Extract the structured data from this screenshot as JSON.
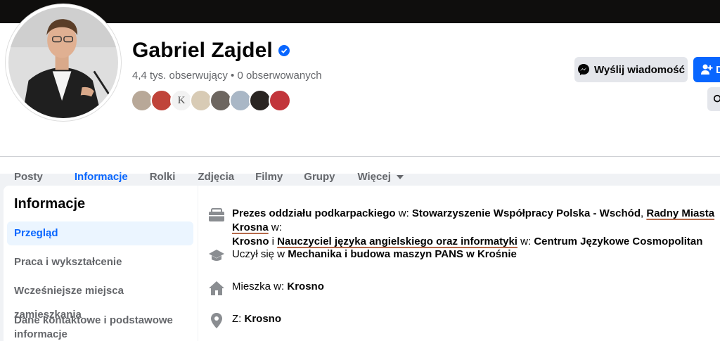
{
  "profile": {
    "name": "Gabriel Zajdel",
    "followers": "4,4 tys. obserwujący • 0 obserwowanych",
    "follower_avatar_letter": "K",
    "verified_icon": "verified-badge-icon"
  },
  "actions": {
    "message_label": "Wyślij wiadomość",
    "add_label": "D"
  },
  "tabs": [
    "Posty",
    "Informacje",
    "Rolki",
    "Zdjęcia",
    "Filmy",
    "Grupy",
    "Więcej"
  ],
  "sidebar": {
    "title": "Informacje",
    "items": [
      {
        "label": "Przegląd",
        "active": true
      },
      {
        "label": "Praca i wykształcenie"
      },
      {
        "label": "Wcześniejsze miejsca zamieszkania"
      },
      {
        "label": "Dane kontaktowe i podstawowe"
      },
      {
        "label": "informacje"
      }
    ]
  },
  "overview": {
    "work": {
      "role1": "Prezes oddziału podkarpackiego",
      "w1": " w: ",
      "org1": "Stowarzyszenie Współpracy Polska - Wschód",
      "sep1": ", ",
      "role2": "Radny Miasta Krosna",
      "w2": " w:",
      "org2": "Krosno",
      "sep2": " i ",
      "role3": "Nauczyciel języka angielskiego oraz informatyki",
      "w3": " w: ",
      "org3": "Centrum Językowe Cosmopolitan"
    },
    "education": {
      "prefix": "Uczył się w ",
      "school": "Mechanika i budowa maszyn PANS w Krośnie"
    },
    "lives": {
      "prefix": "Mieszka w: ",
      "place": "Krosno"
    },
    "from": {
      "prefix": "Z: ",
      "place": "Krosno"
    }
  },
  "colors": {
    "accent": "#0866ff",
    "underline": "#b5694a"
  }
}
